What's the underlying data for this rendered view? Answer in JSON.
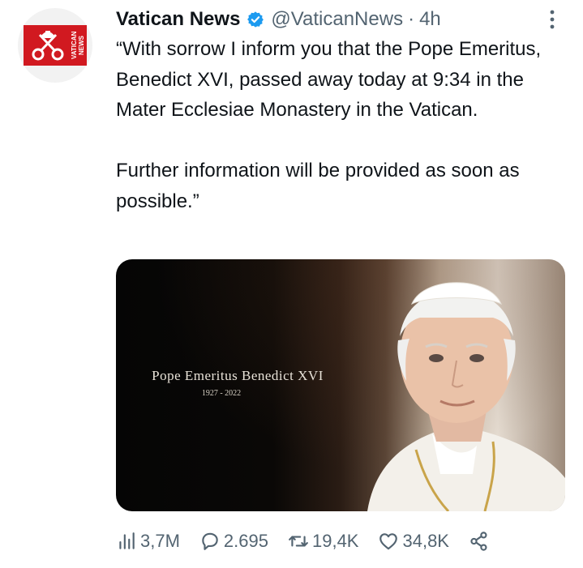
{
  "tweet": {
    "author_name": "Vatican News",
    "handle": "@VaticanNews",
    "separator": "·",
    "time": "4h",
    "avatar_text": "VATICAN NEWS",
    "text": "“With sorrow I inform you that the Pope Emeritus, Benedict XVI, passed away today at 9:34 in the Mater Ecclesiae Monastery in the Vatican.\n\nFurther information will be provided as soon as possible.”",
    "media": {
      "caption_title": "Pope Emeritus Benedict XVI",
      "caption_years": "1927 - 2022"
    },
    "actions": {
      "views": "3,7M",
      "replies": "2.695",
      "retweets": "19,4K",
      "likes": "34,8K"
    }
  },
  "colors": {
    "brand_red": "#d11920",
    "verified_blue": "#1d9bf0",
    "secondary_text": "#536471",
    "primary_text": "#0f1419"
  },
  "icons": [
    "verified-badge-icon",
    "more-icon",
    "views-icon",
    "reply-icon",
    "retweet-icon",
    "like-icon",
    "share-icon"
  ]
}
